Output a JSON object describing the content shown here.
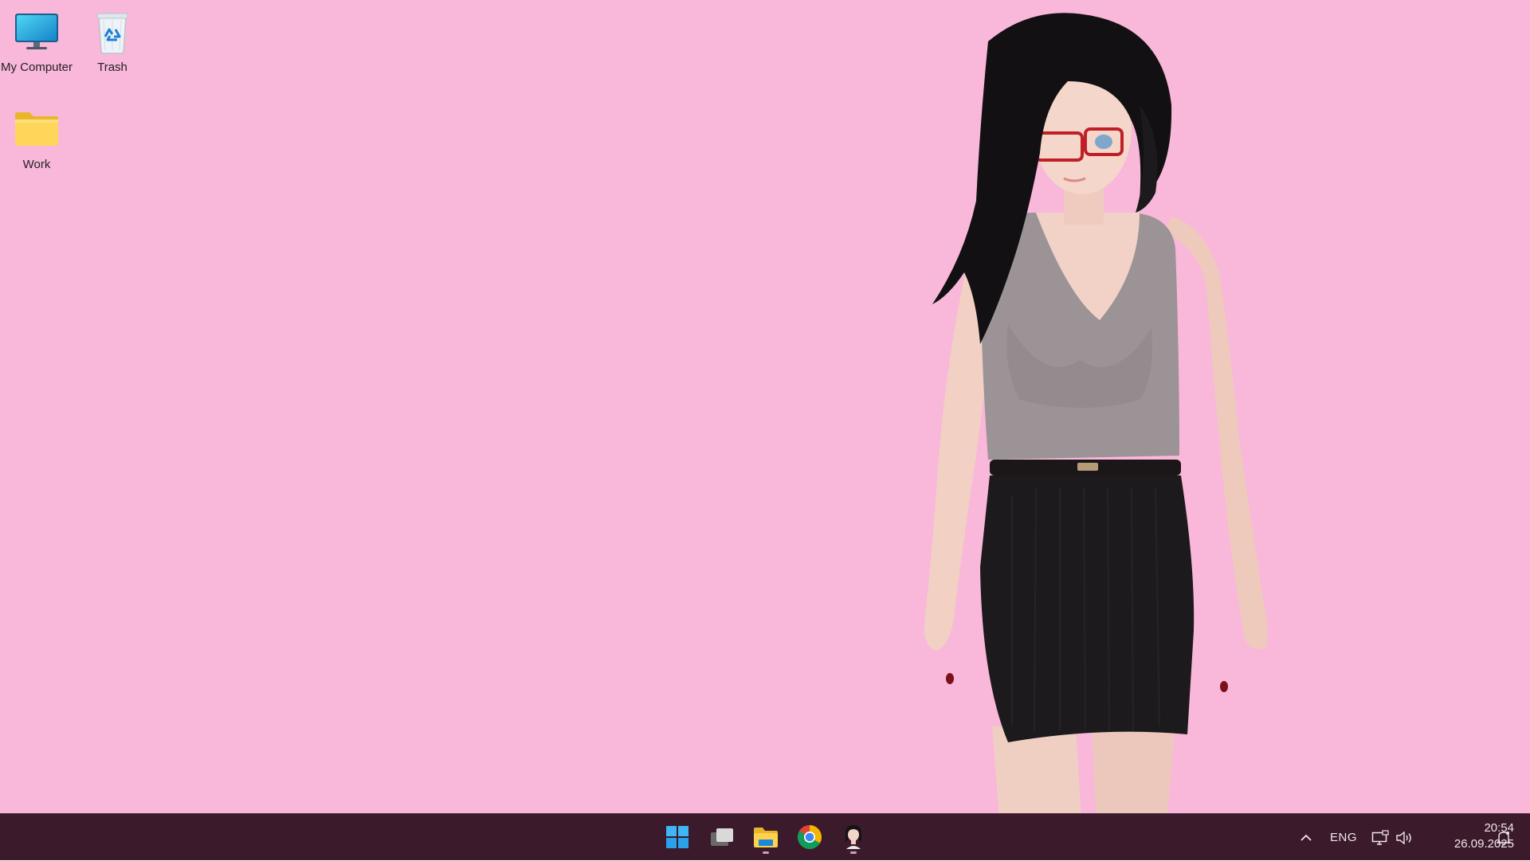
{
  "desktop": {
    "background_color": "#f9b7da",
    "icons": [
      {
        "label": "My Computer",
        "icon": "monitor-icon"
      },
      {
        "label": "Trash",
        "icon": "recycle-bin-icon"
      },
      {
        "label": "Work",
        "icon": "folder-icon"
      }
    ],
    "wallpaper_character": "anime-woman-glasses-grey-top-black-skirt"
  },
  "taskbar": {
    "background_color": "#3a1a2b",
    "apps": [
      {
        "icon": "windows-start-icon",
        "running": false
      },
      {
        "icon": "task-view-icon",
        "running": false
      },
      {
        "icon": "file-explorer-icon",
        "running": true
      },
      {
        "icon": "chrome-icon",
        "running": false
      },
      {
        "icon": "avatar-app-icon",
        "running": true
      }
    ],
    "tray": {
      "overflow_icon": "chevron-up-icon",
      "language": "ENG",
      "network_icon": "network-icon",
      "volume_icon": "volume-icon",
      "time": "20:54",
      "date": "26.09.2025",
      "notification_icon": "notification-icon"
    }
  }
}
